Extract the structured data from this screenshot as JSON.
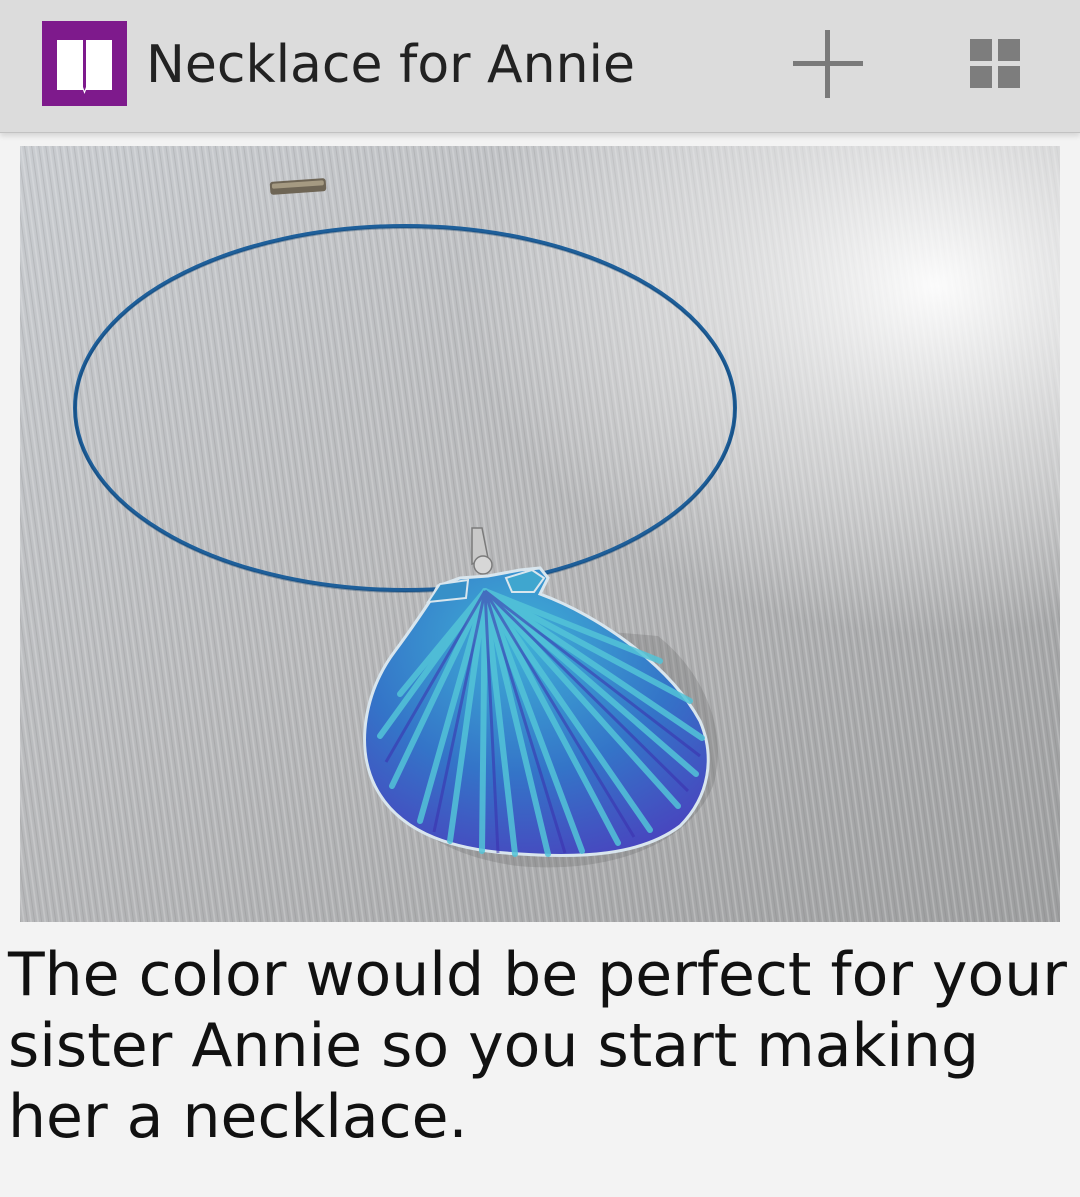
{
  "app_bar": {
    "title": "Necklace for Annie",
    "accent_color": "#7e1a8c",
    "icons": {
      "app": "book-icon",
      "add": "plus-icon",
      "view": "grid-icon"
    }
  },
  "content": {
    "photo_subject": "seashell-necklace-photo",
    "caption": "The color would be perfect for your sister Annie so you start making her a necklace."
  }
}
